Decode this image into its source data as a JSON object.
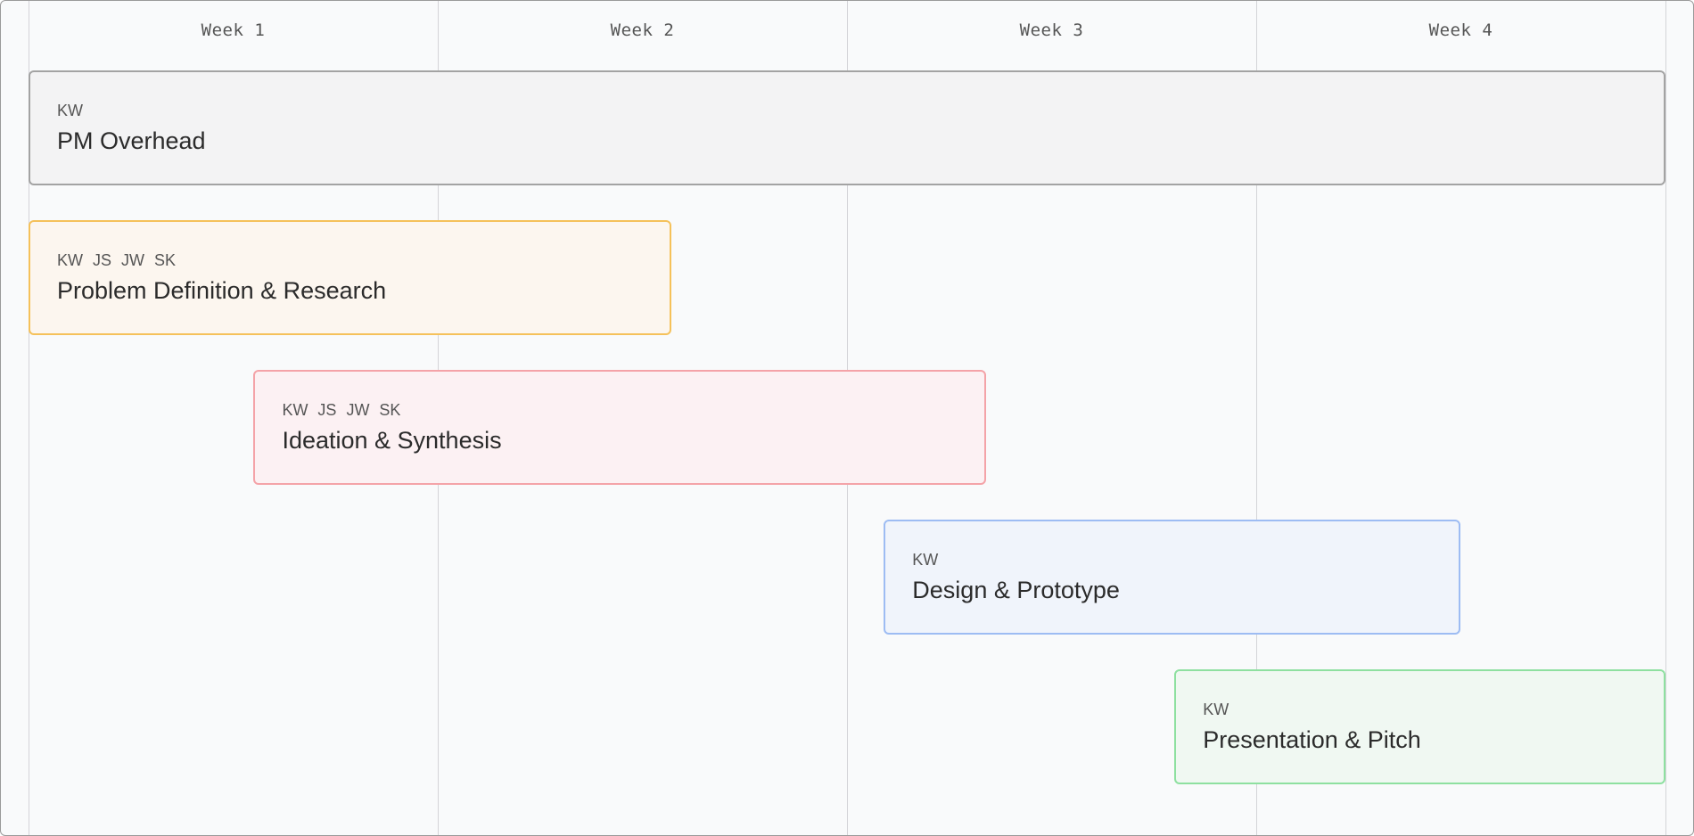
{
  "weeks": [
    "Week 1",
    "Week 2",
    "Week 3",
    "Week 4"
  ],
  "tasks": [
    {
      "assignees": "KW",
      "name": "PM Overhead",
      "start_week": 0.0,
      "end_week": 4.0,
      "fill": "#f3f3f4",
      "border": "#a3a3a3"
    },
    {
      "assignees": "KW JS JW SK",
      "name": "Problem Definition & Research",
      "start_week": 0.0,
      "end_week": 1.57,
      "fill": "#fcf6ef",
      "border": "#f5c15a"
    },
    {
      "assignees": "KW JS JW SK",
      "name": "Ideation & Synthesis",
      "start_week": 0.55,
      "end_week": 2.34,
      "fill": "#fcf1f3",
      "border": "#f4a3a8"
    },
    {
      "assignees": "KW",
      "name": "Design & Prototype",
      "start_week": 2.09,
      "end_week": 3.5,
      "fill": "#f0f4fb",
      "border": "#9dbcf3"
    },
    {
      "assignees": "KW",
      "name": "Presentation & Pitch",
      "start_week": 2.8,
      "end_week": 4.0,
      "fill": "#f0f8f2",
      "border": "#8ee0a0"
    }
  ]
}
